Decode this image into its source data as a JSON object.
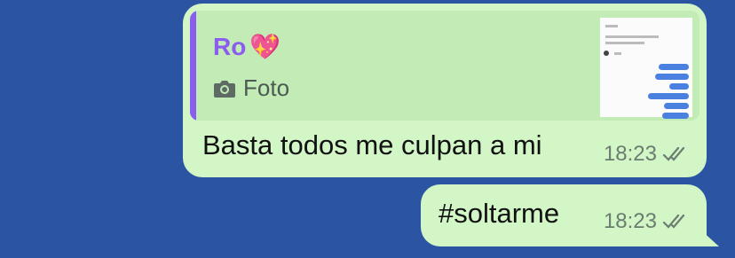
{
  "messages": [
    {
      "reply": {
        "author": "Ro",
        "emoji": "💖",
        "type_label": "Foto"
      },
      "text": "Basta todos me culpan a mi",
      "time": "18:23",
      "status_icon": "double-check-icon"
    },
    {
      "text": "#soltarme",
      "time": "18:23",
      "status_icon": "double-check-icon"
    }
  ],
  "colors": {
    "background": "#2b55a2",
    "bubble": "#d2f6c6",
    "quote_accent": "#8a5cf0",
    "meta_text": "#6a7d70"
  }
}
